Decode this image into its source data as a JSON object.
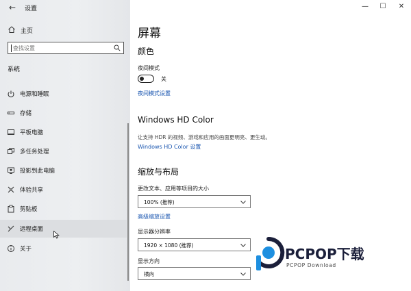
{
  "window": {
    "title": "设置",
    "back_icon": "back-arrow-icon",
    "controls": [
      "minimize-icon",
      "maximize-icon",
      "close-icon"
    ]
  },
  "sidebar": {
    "home_label": "主页",
    "search_placeholder": "查找设置",
    "section_label": "系统",
    "items": [
      {
        "label": "电源和睡眠",
        "icon": "power-icon"
      },
      {
        "label": "存储",
        "icon": "storage-icon"
      },
      {
        "label": "平板电脑",
        "icon": "tablet-icon"
      },
      {
        "label": "多任务处理",
        "icon": "multitask-icon"
      },
      {
        "label": "投影到此电脑",
        "icon": "project-icon"
      },
      {
        "label": "体验共享",
        "icon": "shared-experience-icon"
      },
      {
        "label": "剪贴板",
        "icon": "clipboard-icon"
      },
      {
        "label": "远程桌面",
        "icon": "remote-desktop-icon"
      },
      {
        "label": "关于",
        "icon": "info-icon"
      }
    ]
  },
  "main": {
    "title": "屏幕",
    "color_section": {
      "heading": "颜色",
      "night_mode_label": "夜间模式",
      "night_mode_state": "关",
      "night_mode_on": false,
      "night_mode_link": "夜间模式设置"
    },
    "hd_color": {
      "heading": "Windows HD Color",
      "description": "让支持 HDR 的视频、游戏和应用的画面更明亮、更生动。",
      "link": "Windows HD Color 设置"
    },
    "scale_layout": {
      "heading": "缩放与布局",
      "scale_label": "更改文本、应用等项目的大小",
      "scale_value": "100% (推荐)",
      "advanced_link": "高级缩放设置",
      "resolution_label": "显示器分辨率",
      "resolution_value": "1920 × 1080 (推荐)",
      "orientation_label": "显示方向",
      "orientation_value": "横向"
    }
  },
  "watermark": {
    "brand": "PCPOP下载",
    "sub": "PCPOP Download",
    "colors": {
      "blue": "#1d8fe0",
      "dark": "#1b1f3a"
    }
  }
}
